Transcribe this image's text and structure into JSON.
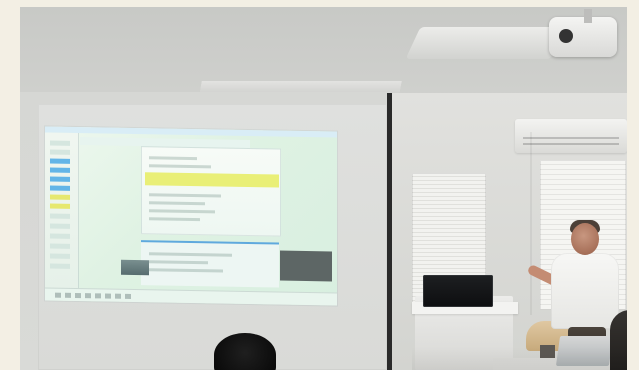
{
  "scene": {
    "type": "photo",
    "subject": "presentation"
  }
}
